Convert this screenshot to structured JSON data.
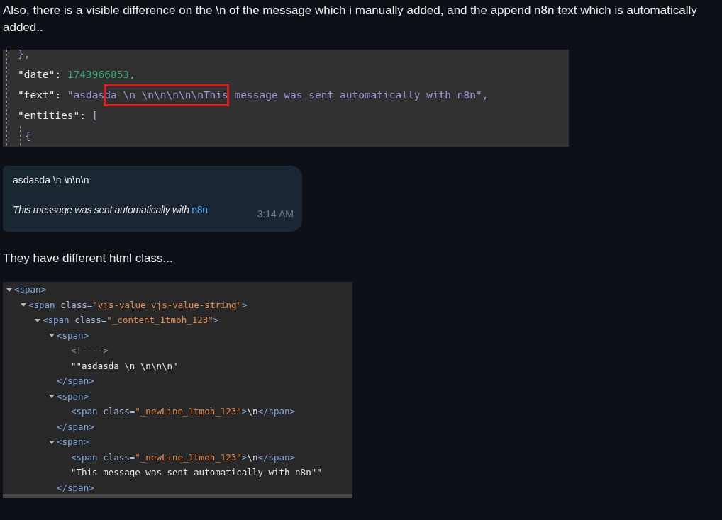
{
  "post": {
    "paragraph_1": "Also, there is a visible difference on the \\n of the message which i manually added, and the append n8n text which is automatically added..",
    "json_view": {
      "lines": [
        {
          "tokens": [
            {
              "kind": "punct",
              "text": "},"
            }
          ],
          "highlight": false
        },
        {
          "tokens": [
            {
              "kind": "key",
              "text": "\"date\":"
            },
            {
              "kind": "number",
              "text": "1743966853"
            },
            {
              "kind": "punct",
              "text": ","
            }
          ],
          "highlight": false
        },
        {
          "tokens": [
            {
              "kind": "key",
              "text": "\"text\":"
            },
            {
              "kind": "string",
              "text": "\"asdasda \\n \\n\\n\\n\\n\\nThis message was sent automatically with n8n\""
            },
            {
              "kind": "punct",
              "text": ","
            }
          ],
          "highlight": true
        },
        {
          "tokens": [
            {
              "kind": "key",
              "text": "\"entities\":"
            },
            {
              "kind": "punct",
              "text": "["
            }
          ],
          "highlight": false
        },
        {
          "tokens": [
            {
              "kind": "punct",
              "text": "{"
            }
          ],
          "highlight": false,
          "nested": true
        }
      ]
    },
    "chat_message": {
      "text": "asdasda \\n \\n\\n\\n",
      "footer": "This message was sent automatically with",
      "footer_link": "n8n",
      "time": "3:14 AM"
    },
    "paragraph_2": "They have different html class...",
    "dom_tree": {
      "nodes": [
        {
          "kind": "element",
          "expanded": true,
          "tokens": [
            {
              "kind": "tag",
              "text": "<span>"
            }
          ],
          "children": [
            {
              "kind": "element",
              "expanded": true,
              "tokens": [
                {
                  "kind": "tag",
                  "text": "<span "
                },
                {
                  "kind": "attr",
                  "text": "class="
                },
                {
                  "kind": "value",
                  "text": "\"vjs-value vjs-value-string\""
                },
                {
                  "kind": "tag",
                  "text": ">"
                }
              ],
              "children": [
                {
                  "kind": "element",
                  "expanded": true,
                  "tokens": [
                    {
                      "kind": "tag",
                      "text": "<span "
                    },
                    {
                      "kind": "attr",
                      "text": "class="
                    },
                    {
                      "kind": "value",
                      "text": "\"_content_1tmoh_123\""
                    },
                    {
                      "kind": "tag",
                      "text": ">"
                    }
                  ],
                  "children": [
                    {
                      "kind": "element",
                      "expanded": true,
                      "tokens": [
                        {
                          "kind": "tag",
                          "text": "<span>"
                        }
                      ],
                      "closing": "</span>",
                      "children": [
                        {
                          "kind": "leaf",
                          "tokens": [
                            {
                              "kind": "comment",
                              "text": "<!---->"
                            }
                          ]
                        },
                        {
                          "kind": "leaf",
                          "tokens": [
                            {
                              "kind": "text",
                              "text": "\"\"asdasda \\n \\n\\n\\n\""
                            }
                          ]
                        }
                      ]
                    },
                    {
                      "kind": "element",
                      "expanded": true,
                      "tokens": [
                        {
                          "kind": "tag",
                          "text": "<span>"
                        }
                      ],
                      "closing": "</span>",
                      "children": [
                        {
                          "kind": "leaf",
                          "tokens": [
                            {
                              "kind": "tag",
                              "text": "<span "
                            },
                            {
                              "kind": "attr",
                              "text": "class="
                            },
                            {
                              "kind": "value",
                              "text": "\"_newLine_1tmoh_123\""
                            },
                            {
                              "kind": "tag",
                              "text": ">"
                            },
                            {
                              "kind": "text",
                              "text": "\\n"
                            },
                            {
                              "kind": "tag",
                              "text": "</span>"
                            }
                          ]
                        }
                      ]
                    },
                    {
                      "kind": "element",
                      "expanded": true,
                      "tokens": [
                        {
                          "kind": "tag",
                          "text": "<span>"
                        }
                      ],
                      "closing": "</span>",
                      "children": [
                        {
                          "kind": "leaf",
                          "tokens": [
                            {
                              "kind": "tag",
                              "text": "<span "
                            },
                            {
                              "kind": "attr",
                              "text": "class="
                            },
                            {
                              "kind": "value",
                              "text": "\"_newLine_1tmoh_123\""
                            },
                            {
                              "kind": "tag",
                              "text": ">"
                            },
                            {
                              "kind": "text",
                              "text": "\\n"
                            },
                            {
                              "kind": "tag",
                              "text": "</span>"
                            }
                          ]
                        },
                        {
                          "kind": "leaf",
                          "tokens": [
                            {
                              "kind": "text",
                              "text": "\"This message was sent automatically with n8n\"\""
                            }
                          ]
                        }
                      ]
                    }
                  ]
                }
              ]
            }
          ]
        }
      ]
    }
  }
}
